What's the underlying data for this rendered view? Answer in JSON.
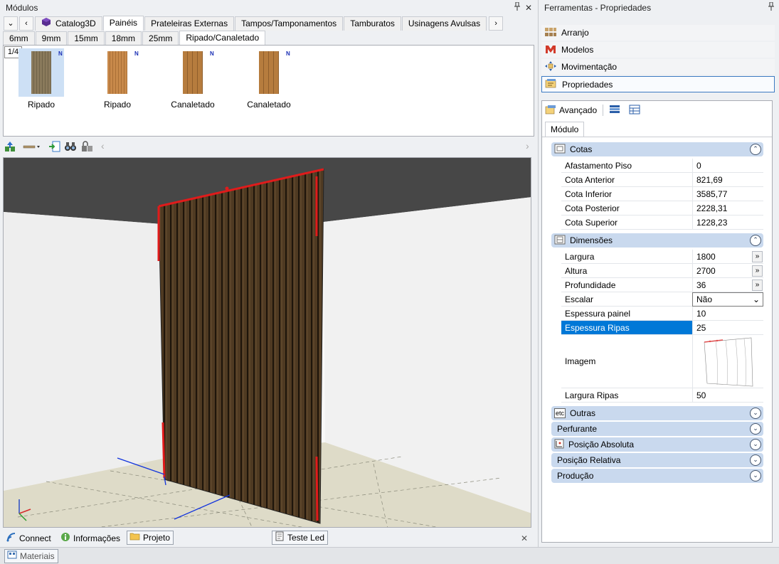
{
  "left_panel": {
    "title": "Módulos",
    "pin_glyph": "📌",
    "close_glyph": "✕",
    "tabs": [
      {
        "label": "Catalog3D",
        "icon": "cube-icon"
      },
      {
        "label": "Painéis"
      },
      {
        "label": "Prateleiras Externas"
      },
      {
        "label": "Tampos/Tamponamentos"
      },
      {
        "label": "Tamburatos"
      },
      {
        "label": "Usinagens Avulsas"
      }
    ],
    "nav": {
      "down": "⌄",
      "prev": "‹",
      "next": "›"
    },
    "subtabs": [
      "6mm",
      "9mm",
      "15mm",
      "18mm",
      "25mm",
      "Ripado/Canaletado"
    ],
    "page_indicator": "1/4",
    "thumbnails": [
      {
        "label": "Ripado",
        "badge": "N",
        "color": "#8a7a5c"
      },
      {
        "label": "Ripado",
        "badge": "N",
        "color": "#c8894a"
      },
      {
        "label": "Canaletado",
        "badge": "N",
        "color": "#b67c3e"
      },
      {
        "label": "Canaletado",
        "badge": "N",
        "color": "#b67c3e"
      }
    ],
    "toolbar_scroll": {
      "left": "‹",
      "right": "›"
    }
  },
  "bottom_tabs": [
    {
      "label": "Connect",
      "icon": "connect-icon"
    },
    {
      "label": "Informações",
      "icon": "info-icon"
    },
    {
      "label": "Projeto",
      "icon": "folder-icon"
    },
    {
      "label": "Teste Led",
      "icon": "document-icon"
    }
  ],
  "bottom_close": "✕",
  "status_tab": {
    "label": "Materiais",
    "icon": "materials-icon"
  },
  "right_panel": {
    "title": "Ferramentas - Propriedades",
    "pin_glyph": "📌",
    "nav_items": [
      {
        "label": "Arranjo",
        "icon": "arrangement-icon"
      },
      {
        "label": "Modelos",
        "icon": "models-icon"
      },
      {
        "label": "Movimentação",
        "icon": "move-icon"
      },
      {
        "label": "Propriedades",
        "icon": "properties-icon"
      }
    ],
    "props_toolbar_label": "Avançado",
    "inner_tab": "Módulo",
    "sections": {
      "cotas": {
        "title": "Cotas",
        "rows": [
          {
            "key": "Afastamento Piso",
            "value": "0"
          },
          {
            "key": "Cota Anterior",
            "value": "821,69"
          },
          {
            "key": "Cota Inferior",
            "value": "3585,77"
          },
          {
            "key": "Cota Posterior",
            "value": "2228,31"
          },
          {
            "key": "Cota Superior",
            "value": "1228,23"
          }
        ]
      },
      "dimensoes": {
        "title": "Dimensões",
        "rows": [
          {
            "key": "Largura",
            "value": "1800",
            "more": "»"
          },
          {
            "key": "Altura",
            "value": "2700",
            "more": "»"
          },
          {
            "key": "Profundidade",
            "value": "36",
            "more": "»"
          },
          {
            "key": "Escalar",
            "value": "Não",
            "dropdown": "⌄"
          },
          {
            "key": "Espessura painel",
            "value": "10"
          },
          {
            "key": "Espessura Ripas",
            "value": "25"
          },
          {
            "key": "Imagem",
            "value": ""
          },
          {
            "key": "Largura Ripas",
            "value": "50"
          }
        ]
      },
      "collapsed": [
        {
          "title": "Outras",
          "icon": "etc-icon",
          "icon_text": "etc"
        },
        {
          "title": "Perfurante"
        },
        {
          "title": "Posição Absoluta",
          "icon": "position-icon"
        },
        {
          "title": "Posição Relativa"
        },
        {
          "title": "Produção"
        }
      ]
    }
  },
  "colors": {
    "accent": "#0078d7",
    "section_header": "#c9d9ee",
    "wood": "#4a3621",
    "highlight_red": "#e01b1b"
  }
}
